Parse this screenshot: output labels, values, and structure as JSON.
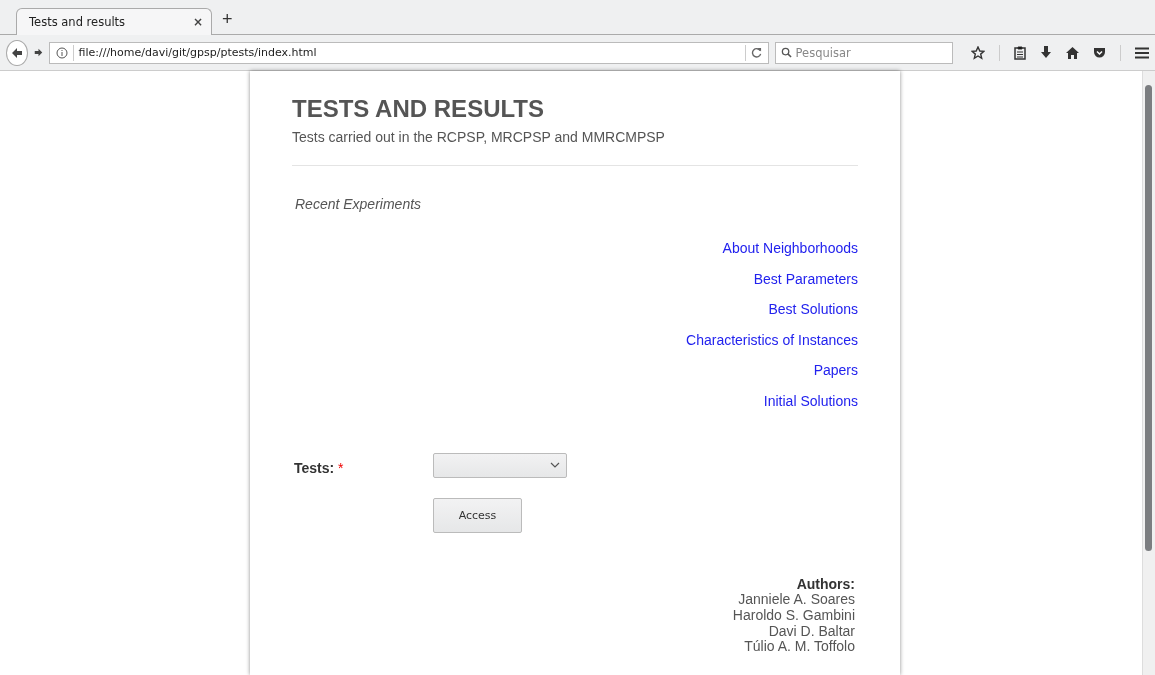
{
  "browser": {
    "tab": {
      "title": "Tests and results",
      "close": "×",
      "new_tab": "+"
    },
    "address": "file:///home/davi/git/gpsp/ptests/index.html",
    "search": {
      "placeholder": "Pesquisar"
    }
  },
  "page": {
    "title": "TESTS AND RESULTS",
    "subtitle": "Tests carried out in the RCPSP, MRCPSP and MMRCMPSP",
    "section": "Recent Experiments",
    "links": [
      "About Neighborhoods",
      "Best Parameters",
      "Best Solutions",
      "Characteristics of Instances",
      "Papers",
      "Initial Solutions"
    ],
    "form": {
      "label": "Tests:",
      "required": true,
      "required_mark": "*",
      "button": "Access"
    },
    "authors": {
      "heading": "Authors:",
      "names": [
        "Janniele A. Soares",
        "Haroldo S. Gambini",
        "Davi D. Baltar",
        "Túlio A. M. Toffolo"
      ]
    }
  }
}
